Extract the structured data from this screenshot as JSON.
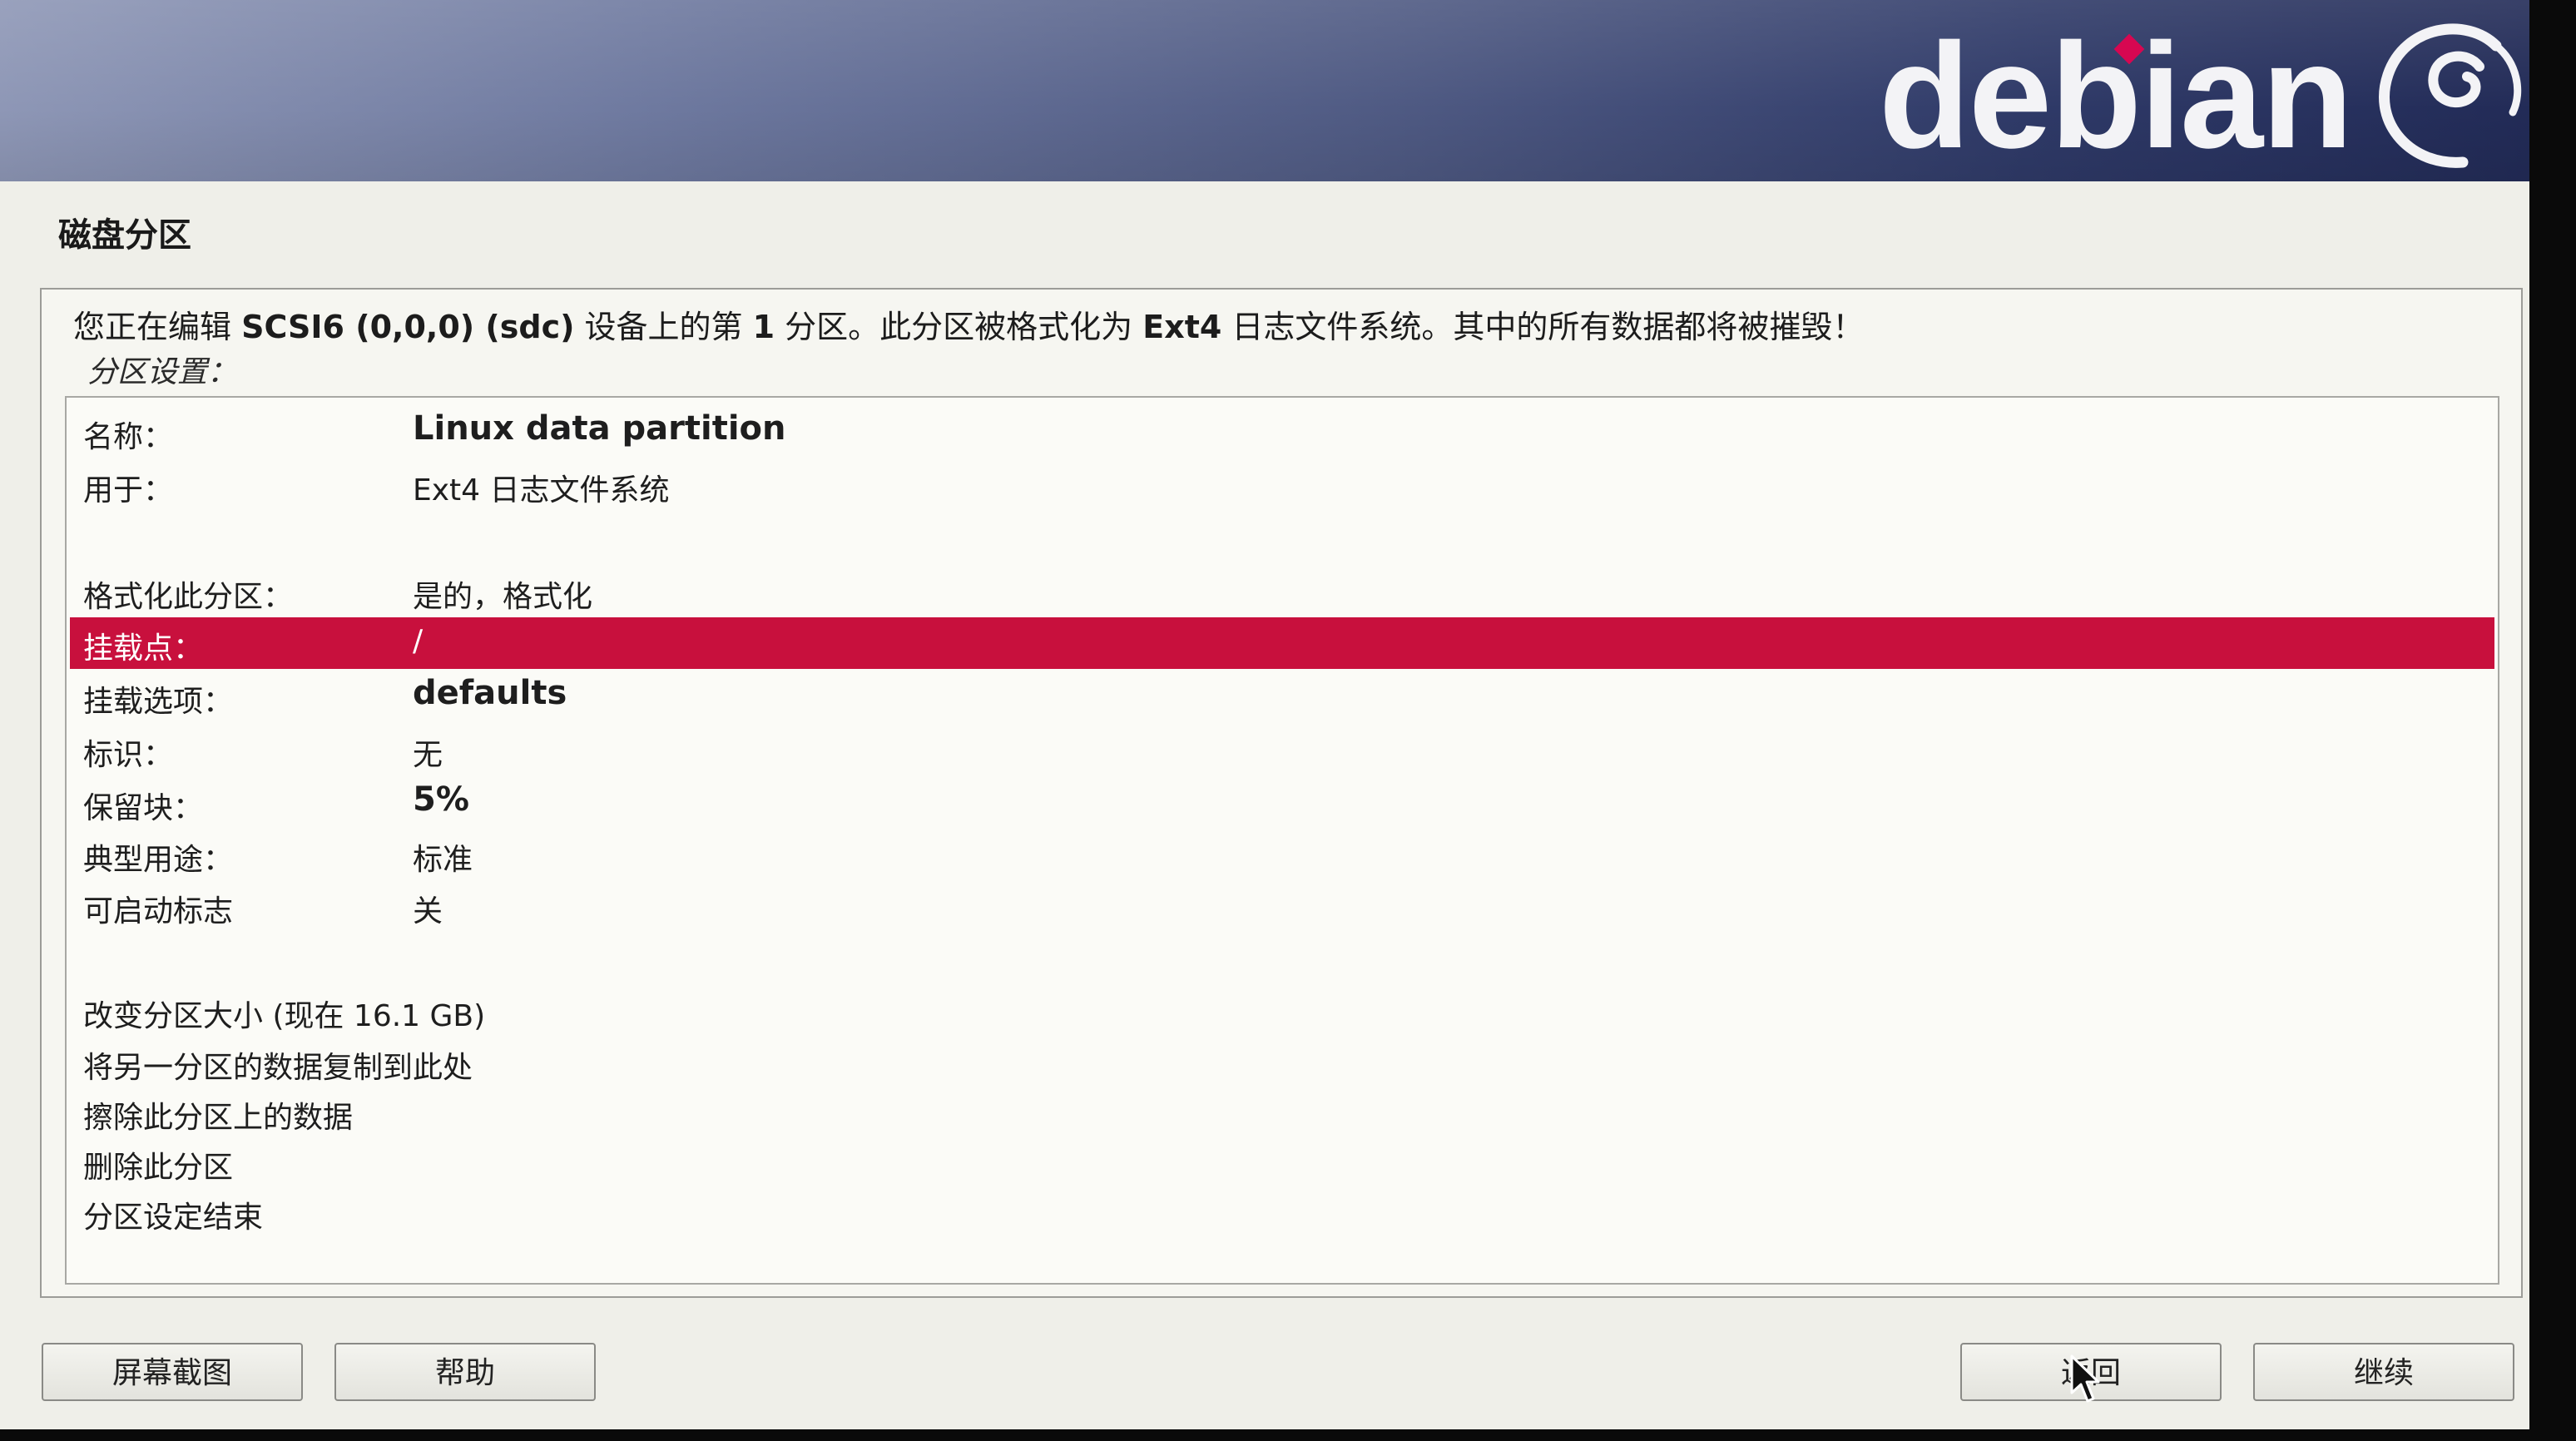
{
  "header": {
    "logo_text": "debian",
    "brand_colors": {
      "banner_left": "#8e97b6",
      "banner_right": "#222b57",
      "logo_dot": "#d70751"
    }
  },
  "page": {
    "title": "磁盘分区",
    "description_prefix": "您正在编辑 ",
    "description_device": "SCSI6 (0,0,0) (sdc)",
    "description_middle1": " 设备上的第 ",
    "description_number": "1",
    "description_middle2": " 分区。此分区被格式化为 ",
    "description_fs": "Ext4",
    "description_suffix": " 日志文件系统。其中的所有数据都将被摧毁！",
    "settings_label": "分区设置："
  },
  "settings": [
    {
      "label": "名称：",
      "value": "Linux data partition",
      "bold": true
    },
    {
      "label": "用于：",
      "value": "Ext4 日志文件系统",
      "bold": false
    },
    {
      "label": "格式化此分区：",
      "value": "是的，格式化",
      "bold": false
    },
    {
      "label": "挂载点：",
      "value": "/",
      "bold": false,
      "selected": true
    },
    {
      "label": "挂载选项：",
      "value": "defaults",
      "bold": true
    },
    {
      "label": "标识：",
      "value": "无",
      "bold": false
    },
    {
      "label": "保留块：",
      "value": "5%",
      "bold": true
    },
    {
      "label": "典型用途：",
      "value": "标准",
      "bold": false
    },
    {
      "label": "可启动标志",
      "value": "关",
      "bold": false
    }
  ],
  "actions": [
    {
      "label": "改变分区大小 (现在 16.1 GB)"
    },
    {
      "label": "将另一分区的数据复制到此处"
    },
    {
      "label": "擦除此分区上的数据"
    },
    {
      "label": "删除此分区"
    },
    {
      "label": "分区设定结束"
    }
  ],
  "buttons": {
    "screenshot": "屏幕截图",
    "help": "帮助",
    "back": "返回",
    "continue": "继续"
  },
  "colors": {
    "selection": "#c8103d",
    "panel_bg": "#efefe9"
  }
}
